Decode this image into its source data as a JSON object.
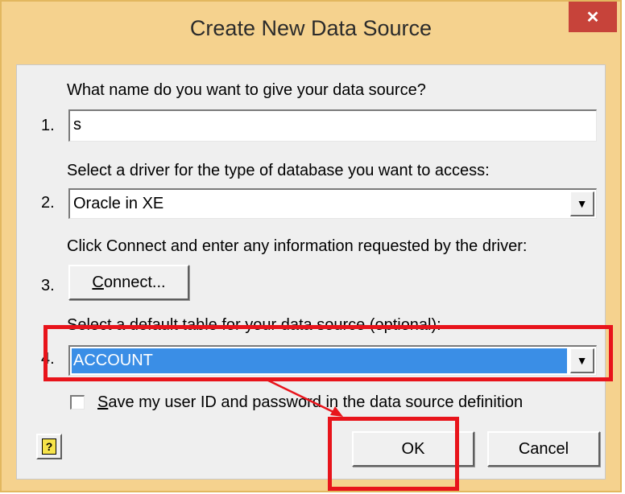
{
  "window": {
    "title": "Create New Data Source",
    "close_icon": "close-icon",
    "close_glyph": "✕"
  },
  "step1": {
    "number": "1.",
    "label": "What name do you want to give your data source?",
    "value": "s"
  },
  "step2": {
    "number": "2.",
    "label": "Select a driver for the type of database you want to access:",
    "selected": "Oracle in XE"
  },
  "step3": {
    "number": "3.",
    "label": "Click Connect and enter any information requested by the driver:",
    "connect_underlined": "C",
    "connect_rest": "onnect..."
  },
  "step4": {
    "number": "4.",
    "label": "Select a default table for your data source (optional):",
    "selected": "ACCOUNT"
  },
  "save_option": {
    "checked": false,
    "label_underlined": "S",
    "label_rest": "ave my user ID and password in the data source definition"
  },
  "buttons": {
    "ok": "OK",
    "cancel": "Cancel",
    "help_glyph": "?"
  },
  "icons": {
    "dropdown": "chevron-down-icon",
    "dropdown_glyph": "▼",
    "help": "help-icon"
  },
  "colors": {
    "frame": "#f5d28e",
    "close_button": "#c7433a",
    "selection": "#3a8ee6",
    "annotation": "#e8141b"
  }
}
